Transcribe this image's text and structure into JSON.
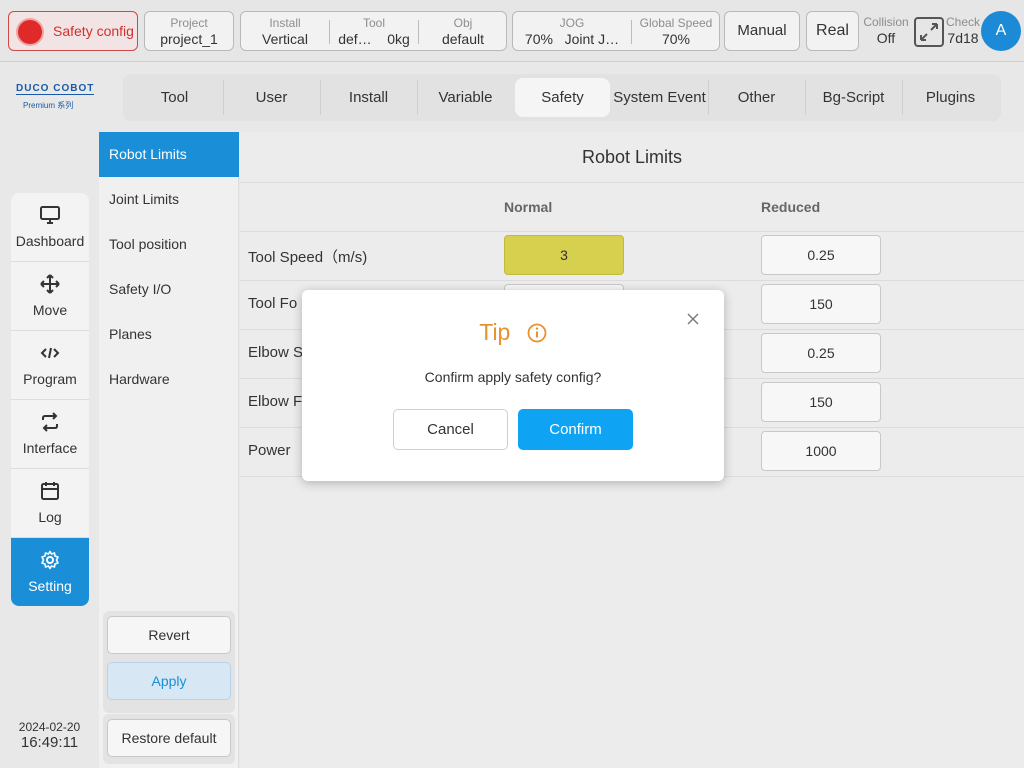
{
  "topbar": {
    "safety_label": "Safety config",
    "project": {
      "label": "Project",
      "value": "project_1"
    },
    "install": {
      "label": "Install",
      "value": "Vertical"
    },
    "tool": {
      "label": "Tool",
      "name": "def…",
      "weight": "0kg"
    },
    "obj": {
      "label": "Obj",
      "value": "default"
    },
    "jog": {
      "label": "JOG",
      "value": "70%",
      "mode": "Joint J…"
    },
    "global_speed": {
      "label": "Global Speed",
      "value": "70%"
    },
    "manual_label": "Manual",
    "real_label": "Real",
    "collision": {
      "label": "Collision",
      "value": "Off"
    },
    "check": {
      "label": "Check",
      "value": "7d18"
    },
    "avatar_letter": "A"
  },
  "logo": {
    "main": "DUCO COBOT",
    "sub": "Premium 系列"
  },
  "nav": {
    "items": [
      {
        "label": "Dashboard",
        "icon": "monitor-icon"
      },
      {
        "label": "Move",
        "icon": "move-arrows-icon"
      },
      {
        "label": "Program",
        "icon": "code-icon"
      },
      {
        "label": "Interface",
        "icon": "swap-icon"
      },
      {
        "label": "Log",
        "icon": "calendar-icon"
      },
      {
        "label": "Setting",
        "icon": "gear-icon",
        "active": true
      }
    ]
  },
  "datetime": {
    "date": "2024-02-20",
    "time": "16:49:11"
  },
  "tabs": [
    "Tool",
    "User",
    "Install",
    "Variable",
    "Safety",
    "System Event",
    "Other",
    "Bg-Script",
    "Plugins"
  ],
  "active_tab": "Safety",
  "side": {
    "items": [
      "Robot Limits",
      "Joint Limits",
      "Tool position",
      "Safety I/O",
      "Planes",
      "Hardware"
    ],
    "active": "Robot Limits",
    "revert_label": "Revert",
    "apply_label": "Apply",
    "restore_label": "Restore default"
  },
  "main": {
    "title": "Robot Limits",
    "col_normal": "Normal",
    "col_reduced": "Reduced",
    "rows": [
      {
        "label": "Tool Speed（m/s)",
        "normal": "3",
        "reduced": "0.25"
      },
      {
        "label": "Tool Fo",
        "reduced": "150"
      },
      {
        "label": "Elbow S",
        "reduced": "0.25"
      },
      {
        "label": "Elbow F",
        "reduced": "150"
      },
      {
        "label": "Power",
        "reduced": "1000"
      }
    ]
  },
  "dialog": {
    "title": "Tip",
    "message": "Confirm apply safety config?",
    "cancel_label": "Cancel",
    "confirm_label": "Confirm"
  },
  "colors": {
    "accent": "#1a8fd8",
    "tip": "#e8912f",
    "confirm": "#0ea4f3",
    "highlight": "#d7cf4e",
    "danger": "#e02a2a"
  }
}
